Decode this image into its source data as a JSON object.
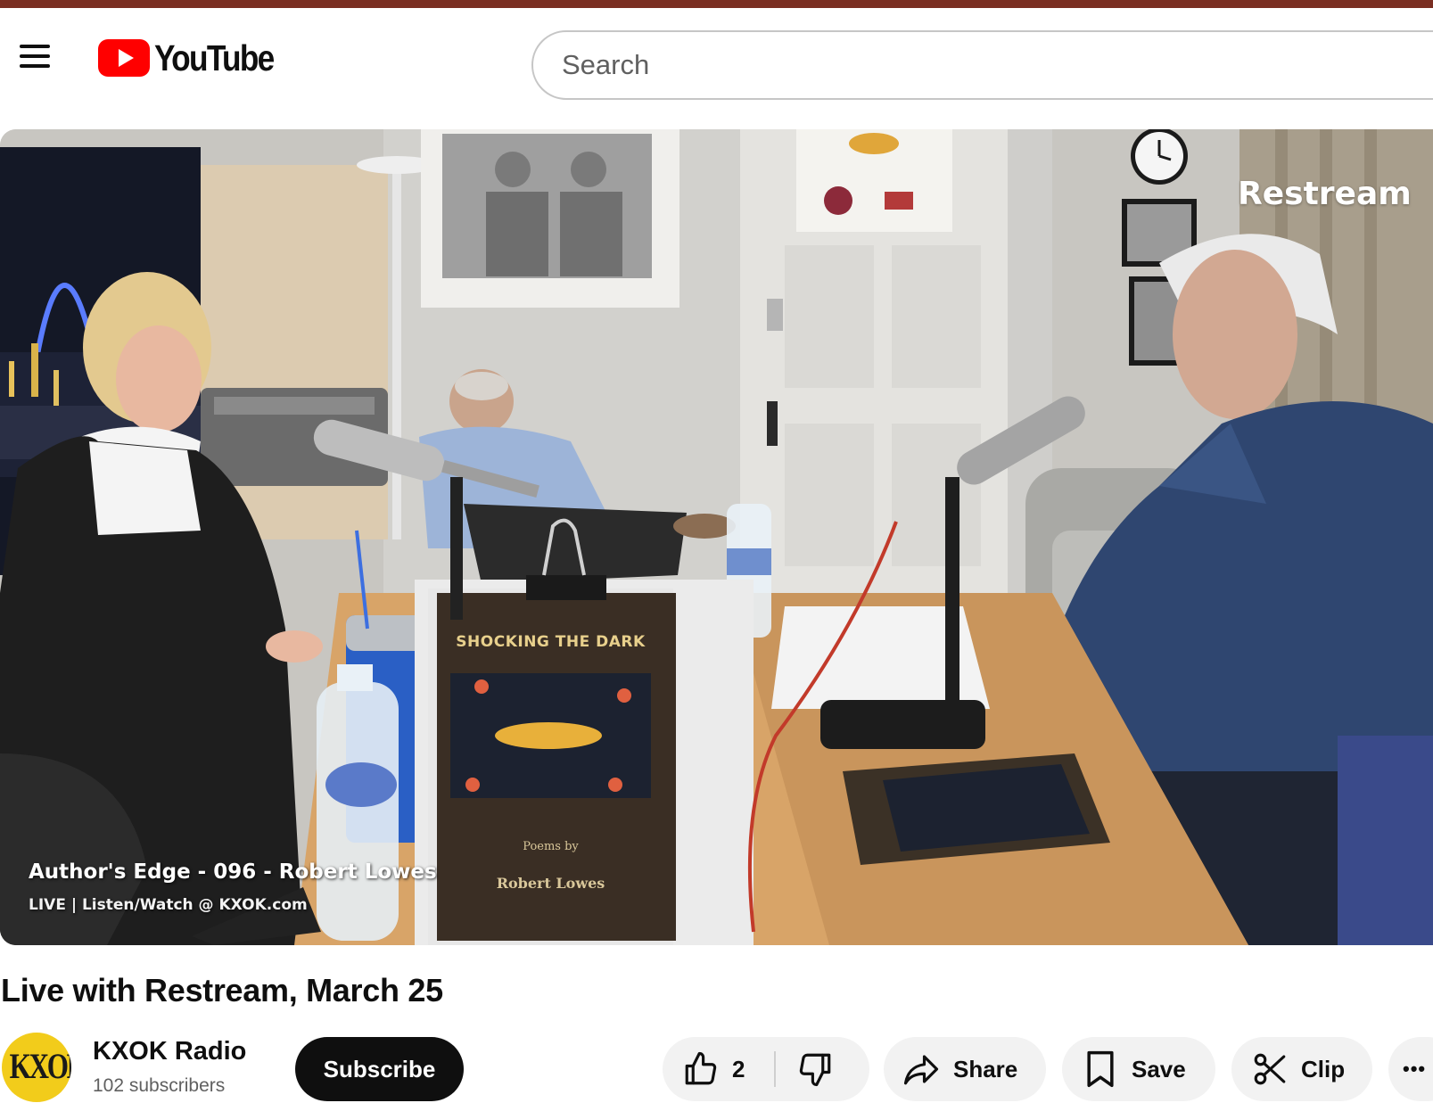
{
  "masthead": {
    "logo_text": "YouTube",
    "search_placeholder": "Search"
  },
  "player": {
    "watermark": "Restream",
    "overlay_title": "Author's Edge - 096 - Robert Lowes",
    "overlay_subtitle": "LIVE | Listen/Watch @ KXOK.com",
    "book_title": "SHOCKING THE DARK",
    "book_subtitle": "Poems by",
    "book_author": "Robert Lowes"
  },
  "video": {
    "title": "Live with Restream, March 25"
  },
  "channel": {
    "avatar_text": "KXOK",
    "name": "KXOK Radio",
    "subscribers": "102 subscribers",
    "subscribe_label": "Subscribe"
  },
  "actions": {
    "like_count": "2",
    "share_label": "Share",
    "save_label": "Save",
    "clip_label": "Clip",
    "more_label": "•••"
  },
  "icons": {
    "menu": "hamburger-icon",
    "logo": "youtube-play-icon",
    "like": "thumbs-up-icon",
    "dislike": "thumbs-down-icon",
    "share": "share-arrow-icon",
    "save": "bookmark-icon",
    "clip": "scissors-icon",
    "more": "ellipsis-icon"
  },
  "colors": {
    "brand_red": "#ff0000",
    "subscribe_bg": "#0f0f0f",
    "pill_bg": "#f2f2f2",
    "secondary_text": "#606060"
  }
}
